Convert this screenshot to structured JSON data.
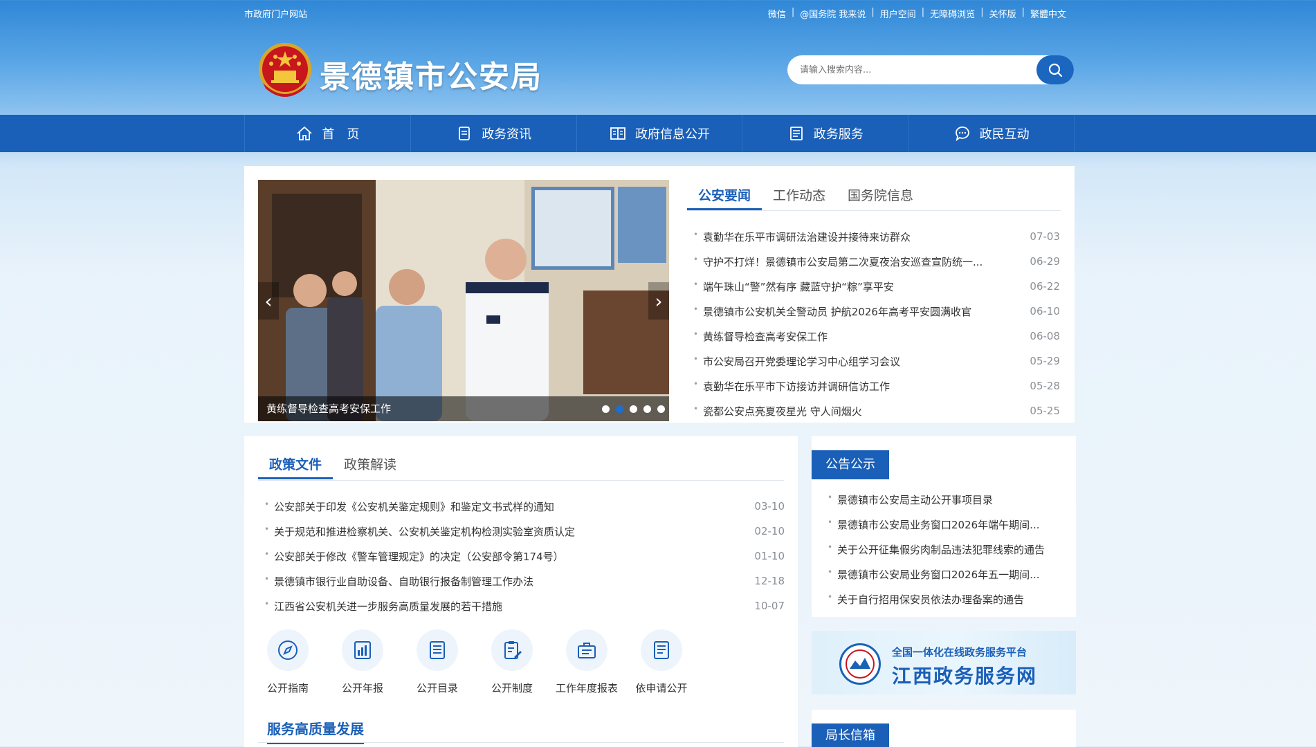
{
  "top_bar": {
    "site_link": "市政府门户网站",
    "links": [
      "微信",
      "@国务院 我来说",
      "用户空间",
      "无障碍浏览",
      "关怀版",
      "繁體中文"
    ]
  },
  "header": {
    "title": "景德镇市公安局",
    "search_placeholder": "请输入搜索内容..."
  },
  "nav": [
    {
      "label": "首　页",
      "icon": "home-icon"
    },
    {
      "label": "政务资讯",
      "icon": "document-icon"
    },
    {
      "label": "政府信息公开",
      "icon": "book-icon"
    },
    {
      "label": "政务服务",
      "icon": "list-icon"
    },
    {
      "label": "政民互动",
      "icon": "chat-icon"
    }
  ],
  "carousel": {
    "caption": "黄练督导检查高考安保工作",
    "slide_count": 5,
    "active_index": 1
  },
  "news_tabs": [
    "公安要闻",
    "工作动态",
    "国务院信息"
  ],
  "news": [
    {
      "title": "袁勤华在乐平市调研法治建设并接待来访群众",
      "date": "07-03"
    },
    {
      "title": "守护不打烊！景德镇市公安局第二次夏夜治安巡查宣防统一...",
      "date": "06-29"
    },
    {
      "title": "端午珠山“警”然有序 藏蓝守护“粽”享平安",
      "date": "06-22"
    },
    {
      "title": "景德镇市公安机关全警动员 护航2026年高考平安圆满收官",
      "date": "06-10"
    },
    {
      "title": "黄练督导检查高考安保工作",
      "date": "06-08"
    },
    {
      "title": "市公安局召开党委理论学习中心组学习会议",
      "date": "05-29"
    },
    {
      "title": "袁勤华在乐平市下访接访并调研信访工作",
      "date": "05-28"
    },
    {
      "title": "瓷都公安点亮夏夜星光 守人间烟火",
      "date": "05-25"
    }
  ],
  "policy_tabs": [
    "政策文件",
    "政策解读"
  ],
  "policy": [
    {
      "title": "公安部关于印发《公安机关鉴定规则》和鉴定文书式样的通知",
      "date": "03-10"
    },
    {
      "title": "关于规范和推进检察机关、公安机关鉴定机构检测实验室资质认定",
      "date": "02-10"
    },
    {
      "title": "公安部关于修改《警车管理规定》的决定（公安部令第174号）",
      "date": "01-10"
    },
    {
      "title": "景德镇市银行业自助设备、自助银行报备制管理工作办法",
      "date": "12-18"
    },
    {
      "title": "江西省公安机关进一步服务高质量发展的若干措施",
      "date": "10-07"
    }
  ],
  "disclosure_icons": [
    {
      "label": "公开指南",
      "icon": "compass-icon"
    },
    {
      "label": "公开年报",
      "icon": "report-chart-icon"
    },
    {
      "label": "公开目录",
      "icon": "catalog-list-icon"
    },
    {
      "label": "公开制度",
      "icon": "clipboard-pen-icon"
    },
    {
      "label": "工作年度报表",
      "icon": "briefcase-icon"
    },
    {
      "label": "依申请公开",
      "icon": "application-doc-icon"
    }
  ],
  "service_section_title": "服务高质量发展",
  "notice": {
    "title": "公告公示",
    "items": [
      "景德镇市公安局主动公开事项目录",
      "景德镇市公安局业务窗口2026年端午期间...",
      "关于公开征集假劣肉制品违法犯罪线索的通告",
      "景德镇市公安局业务窗口2026年五一期间...",
      "关于自行招用保安员依法办理备案的通告"
    ]
  },
  "banner": {
    "subtitle": "全国一体化在线政务服务平台",
    "title": "江西政务服务网"
  },
  "director_mailbox_title": "局长信箱",
  "colors": {
    "primary": "#1a5fb8",
    "date": "#8a8f95"
  }
}
